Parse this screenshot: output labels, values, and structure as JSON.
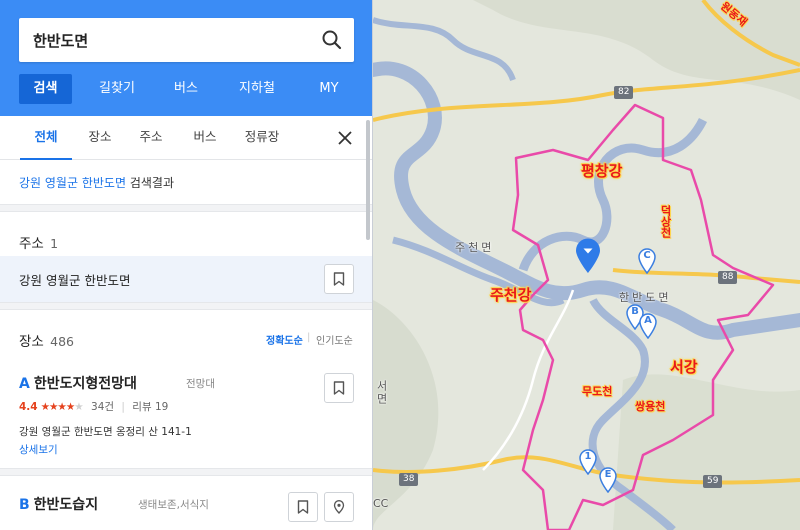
{
  "search": {
    "query": "한반도면"
  },
  "nav": [
    "검색",
    "길찾기",
    "버스",
    "지하철",
    "MY"
  ],
  "tabs": [
    "전체",
    "장소",
    "주소",
    "버스",
    "정류장"
  ],
  "result_caption": {
    "region": "강원 영월군 한반도면",
    "suffix": "검색결과"
  },
  "address_section": {
    "title": "주소",
    "count": "1",
    "item": "강원 영월군 한반도면"
  },
  "place_section": {
    "title": "장소",
    "count": "486",
    "sort_accuracy": "정확도순",
    "sort_popular": "인기도순"
  },
  "places": [
    {
      "letter": "A",
      "name": "한반도지형전망대",
      "category": "전망대",
      "score": "4.4",
      "review_count": "34건",
      "review_label": "리뷰 19",
      "address": "강원 영월군 한반도면 옹정리 산 141-1",
      "detail": "상세보기"
    },
    {
      "letter": "B",
      "name": "한반도습지",
      "category": "생태보존,서식지"
    }
  ],
  "map": {
    "rivers": [
      "평창강",
      "주천강",
      "서강"
    ],
    "streams": [
      "덕상천",
      "무도천",
      "쌍용천"
    ],
    "places": [
      "주천면",
      "한반도면",
      "서면"
    ],
    "edge_label": "원동재",
    "roads": [
      "82",
      "88",
      "38",
      "59"
    ],
    "markers": [
      "C",
      "B",
      "A",
      "1",
      "E"
    ],
    "misc": "CC"
  },
  "colors": {
    "brand": "#3b8cf5",
    "active_nav": "#1566d6",
    "link": "#1a73e8",
    "rating": "#e5421d",
    "boundary": "#e94aa9",
    "river": "#a5b8d6",
    "road": "#f6c84c"
  }
}
